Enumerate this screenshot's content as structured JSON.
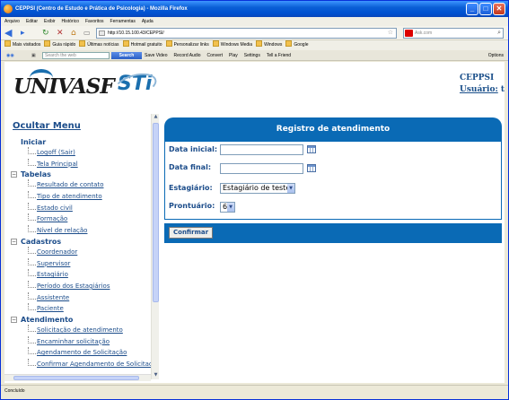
{
  "window": {
    "title": "CEPPSI (Centro de Estudo e Prática de Psicologia) - Mozilla Firefox",
    "btn_min": "_",
    "btn_max": "□",
    "btn_close": "✕"
  },
  "menubar": [
    "Arquivo",
    "Editar",
    "Exibir",
    "Histórico",
    "Favoritos",
    "Ferramentas",
    "Ajuda"
  ],
  "nav": {
    "url": "http://10.15.100.43/CEPPSI/",
    "search_placeholder": "Ask.com"
  },
  "bookmarks": [
    "Mais visitados",
    "Guia rápido",
    "Últimas notícias",
    "Hotmail gratuito",
    "Personalizar links",
    "Windows Media",
    "Windows",
    "Google"
  ],
  "toolbar": {
    "search_placeholder": "Search the web",
    "search_button": "Search",
    "items": [
      "Save Video",
      "Record Audio",
      "Convert",
      "Play",
      "Settings",
      "Tell a Friend"
    ],
    "options": "Options"
  },
  "header": {
    "logo_left": "UNIVASF",
    "logo_right": "STi",
    "org": "CEPPSI",
    "user_label": "Usuário:",
    "user_value": "t"
  },
  "sidebar": {
    "toggle": "Ocultar Menu",
    "groups": [
      {
        "label": "Iniciar",
        "sign": "",
        "items": [
          "Logoff (Sair)",
          "Tela Principal"
        ]
      },
      {
        "label": "Tabelas",
        "sign": "−",
        "items": [
          "Resultado de contato",
          "Tipo de atendimento",
          "Estado civil",
          "Formação",
          "Nível de relação"
        ]
      },
      {
        "label": "Cadastros",
        "sign": "−",
        "items": [
          "Coordenador",
          "Supervisor",
          "Estagiário",
          "Período dos Estagiários",
          "Assistente",
          "Paciente"
        ]
      },
      {
        "label": "Atendimento",
        "sign": "−",
        "items": [
          "Solicitação de atendimento",
          "Encaminhar solicitação",
          "Agendamento de Solicitação",
          "Confirmar Agendamento de Solicitação"
        ]
      }
    ]
  },
  "form": {
    "title": "Registro de atendimento",
    "data_inicial_label": "Data inicial:",
    "data_final_label": "Data final:",
    "estagiario_label": "Estagiário:",
    "estagiario_value": "Estagiário de teste",
    "prontuario_label": "Prontuário:",
    "prontuario_value": "6",
    "confirm_button": "Confirmar"
  },
  "status": "Concluído"
}
